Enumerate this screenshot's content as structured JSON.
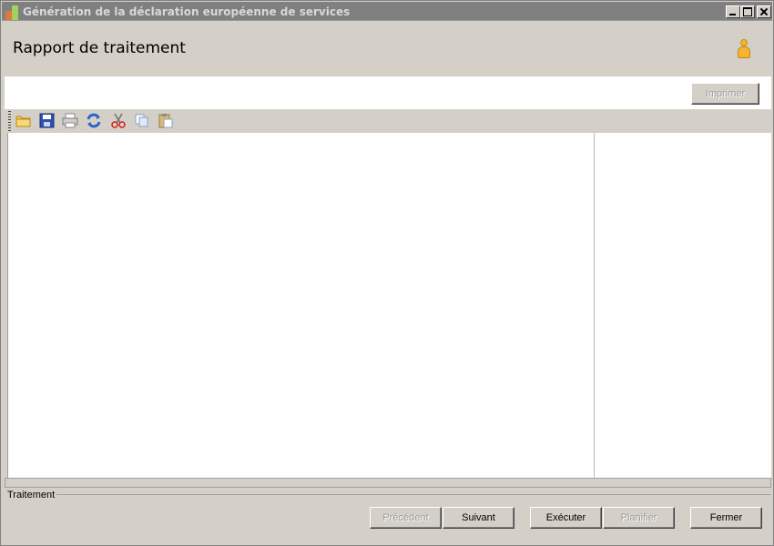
{
  "window": {
    "title": "Génération de la déclaration européenne de services"
  },
  "header": {
    "title": "Rapport de traitement"
  },
  "actions": {
    "print_label": "Imprimer"
  },
  "toolbar": {
    "items": [
      {
        "name": "open-folder-icon"
      },
      {
        "name": "save-disk-icon"
      },
      {
        "name": "print-icon"
      },
      {
        "name": "refresh-icon"
      },
      {
        "name": "cut-icon"
      },
      {
        "name": "copy-icon"
      },
      {
        "name": "paste-icon"
      }
    ]
  },
  "group": {
    "label": "Traitement"
  },
  "footer": {
    "prev_label": "Précédent",
    "next_label": "Suivant",
    "exec_label": "Exécuter",
    "plan_label": "Planifier",
    "close_label": "Fermer"
  }
}
